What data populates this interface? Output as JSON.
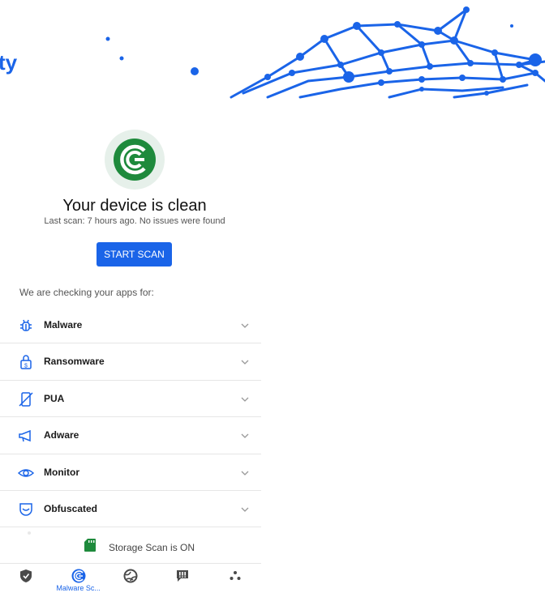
{
  "header": {
    "brand_fragment": "ty"
  },
  "status": {
    "title": "Your device is clean",
    "subtitle": "Last scan: 7 hours ago. No issues were found",
    "icon": "clean-status-icon"
  },
  "scan_button": {
    "label": "START SCAN"
  },
  "checking_label": "We are checking your apps for:",
  "threats": [
    {
      "label": "Malware",
      "icon": "bug-icon"
    },
    {
      "label": "Ransomware",
      "icon": "lock-dollar-icon"
    },
    {
      "label": "PUA",
      "icon": "crossed-phone-icon"
    },
    {
      "label": "Adware",
      "icon": "megaphone-icon"
    },
    {
      "label": "Monitor",
      "icon": "eye-icon"
    },
    {
      "label": "Obfuscated",
      "icon": "mask-shield-icon"
    }
  ],
  "storage": {
    "label": "Storage Scan is ON",
    "icon": "sd-card-icon"
  },
  "bottom_nav": [
    {
      "icon": "shield-icon",
      "label": ""
    },
    {
      "icon": "malware-scanner-icon",
      "label": "Malware Sc..."
    },
    {
      "icon": "globe-icon",
      "label": ""
    },
    {
      "icon": "message-alert-icon",
      "label": ""
    },
    {
      "icon": "more-dots-icon",
      "label": ""
    }
  ],
  "colors": {
    "accent": "#1a64e8",
    "clean_green": "#1e8a3c",
    "clean_bg": "#e6f0ea",
    "icon_blue": "#1a64e8",
    "nav_gray": "#4a4a4a"
  }
}
